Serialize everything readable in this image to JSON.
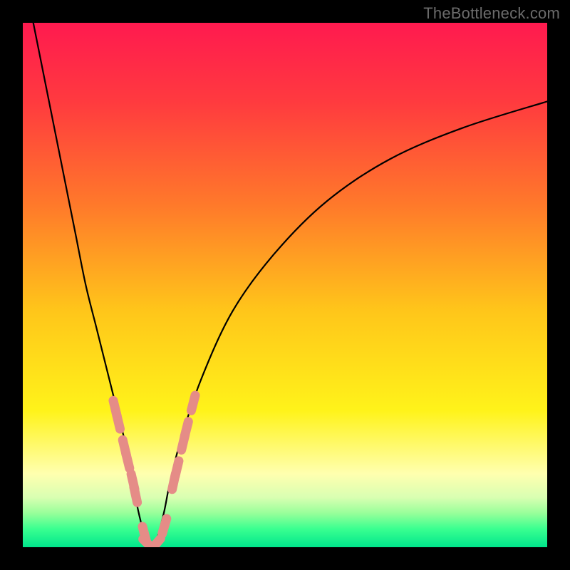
{
  "watermark": "TheBottleneck.com",
  "chart_data": {
    "type": "line",
    "title": "",
    "xlabel": "",
    "ylabel": "",
    "xlim": [
      0,
      100
    ],
    "ylim": [
      0,
      100
    ],
    "grid": false,
    "legend": false,
    "series": [
      {
        "name": "bottleneck-curve",
        "x": [
          0,
          2,
          4,
          6,
          8,
          10,
          12,
          14,
          16,
          18,
          20,
          21,
          22,
          23,
          24,
          25,
          26,
          27,
          28,
          30,
          34,
          40,
          48,
          58,
          70,
          84,
          100
        ],
        "values": [
          110,
          100,
          90,
          80,
          70,
          60,
          50,
          42,
          34,
          26,
          18,
          12,
          7,
          3,
          0,
          0,
          3,
          7,
          12,
          20,
          32,
          45,
          56,
          66,
          74,
          80,
          85
        ]
      }
    ],
    "markers": {
      "name": "data-point-beads",
      "color": "#e58c87",
      "points": [
        {
          "x": 17.6,
          "y": 26.5
        },
        {
          "x": 18.2,
          "y": 24.0
        },
        {
          "x": 19.4,
          "y": 19.0
        },
        {
          "x": 20.0,
          "y": 16.5
        },
        {
          "x": 21.0,
          "y": 12.5
        },
        {
          "x": 21.5,
          "y": 10.0
        },
        {
          "x": 23.2,
          "y": 2.5
        },
        {
          "x": 24.0,
          "y": 0.5
        },
        {
          "x": 25.3,
          "y": 0.5
        },
        {
          "x": 27.0,
          "y": 4.0
        },
        {
          "x": 28.8,
          "y": 12.5
        },
        {
          "x": 29.4,
          "y": 15.0
        },
        {
          "x": 30.6,
          "y": 20.0
        },
        {
          "x": 31.2,
          "y": 22.5
        },
        {
          "x": 32.5,
          "y": 27.5
        }
      ]
    },
    "background_gradient": {
      "stops": [
        {
          "offset": 0.0,
          "color": "#ff1a4f"
        },
        {
          "offset": 0.15,
          "color": "#ff3a3f"
        },
        {
          "offset": 0.35,
          "color": "#ff7a2a"
        },
        {
          "offset": 0.55,
          "color": "#ffc61a"
        },
        {
          "offset": 0.74,
          "color": "#fff31a"
        },
        {
          "offset": 0.86,
          "color": "#ffffaf"
        },
        {
          "offset": 0.905,
          "color": "#d9ffb2"
        },
        {
          "offset": 0.935,
          "color": "#98ff9a"
        },
        {
          "offset": 0.965,
          "color": "#3aff90"
        },
        {
          "offset": 1.0,
          "color": "#00e68c"
        }
      ]
    }
  }
}
